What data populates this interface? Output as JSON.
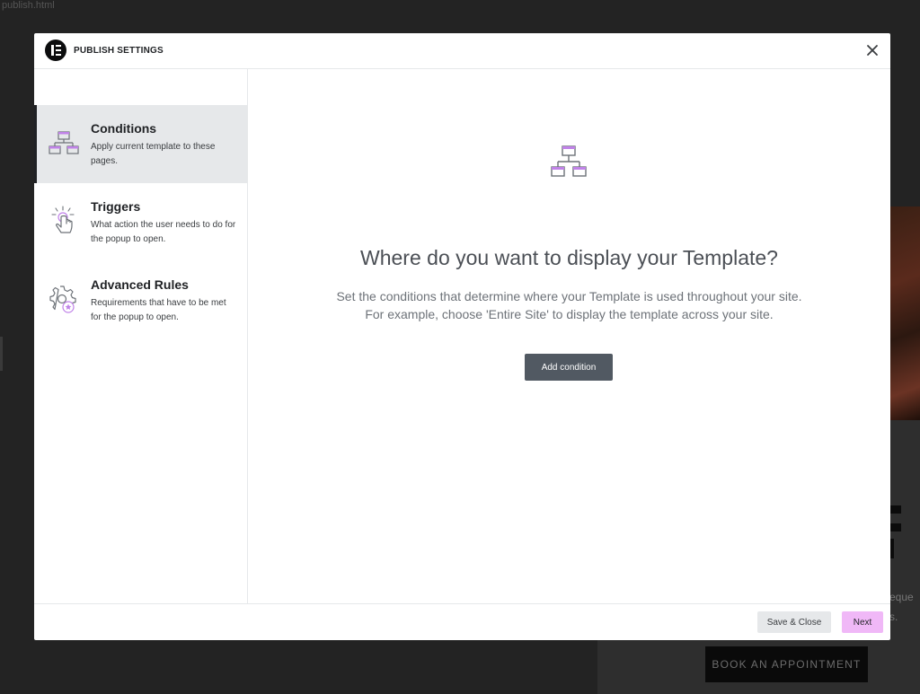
{
  "background": {
    "top_left_text": "publish.html",
    "book_button": "BOOK AN APPOINTMENT",
    "snippet_1": "eque",
    "snippet_2": "s."
  },
  "modal": {
    "title": "PUBLISH SETTINGS",
    "close_icon": "close-icon",
    "logo_icon": "elementor-logo"
  },
  "sidebar": {
    "items": [
      {
        "title": "Conditions",
        "description": "Apply current template to these pages.",
        "icon": "sitemap-icon",
        "active": true
      },
      {
        "title": "Triggers",
        "description": "What action the user needs to do for the popup to open.",
        "icon": "tap-pointer-icon",
        "active": false
      },
      {
        "title": "Advanced Rules",
        "description": "Requirements that have to be met for the popup to open.",
        "icon": "gear-star-icon",
        "active": false
      }
    ]
  },
  "content": {
    "icon": "sitemap-icon",
    "heading": "Where do you want to display your Template?",
    "description_line1": "Set the conditions that determine where your Template is used throughout your site.",
    "description_line2": "For example, choose 'Entire Site' to display the template across your site.",
    "add_button": "Add condition"
  },
  "footer": {
    "save_close": "Save & Close",
    "next": "Next"
  },
  "colors": {
    "accent_pink": "#f0b8f7",
    "icon_purple": "#c082e8",
    "dark_button": "#515962",
    "active_bg": "#e6e8ea"
  }
}
